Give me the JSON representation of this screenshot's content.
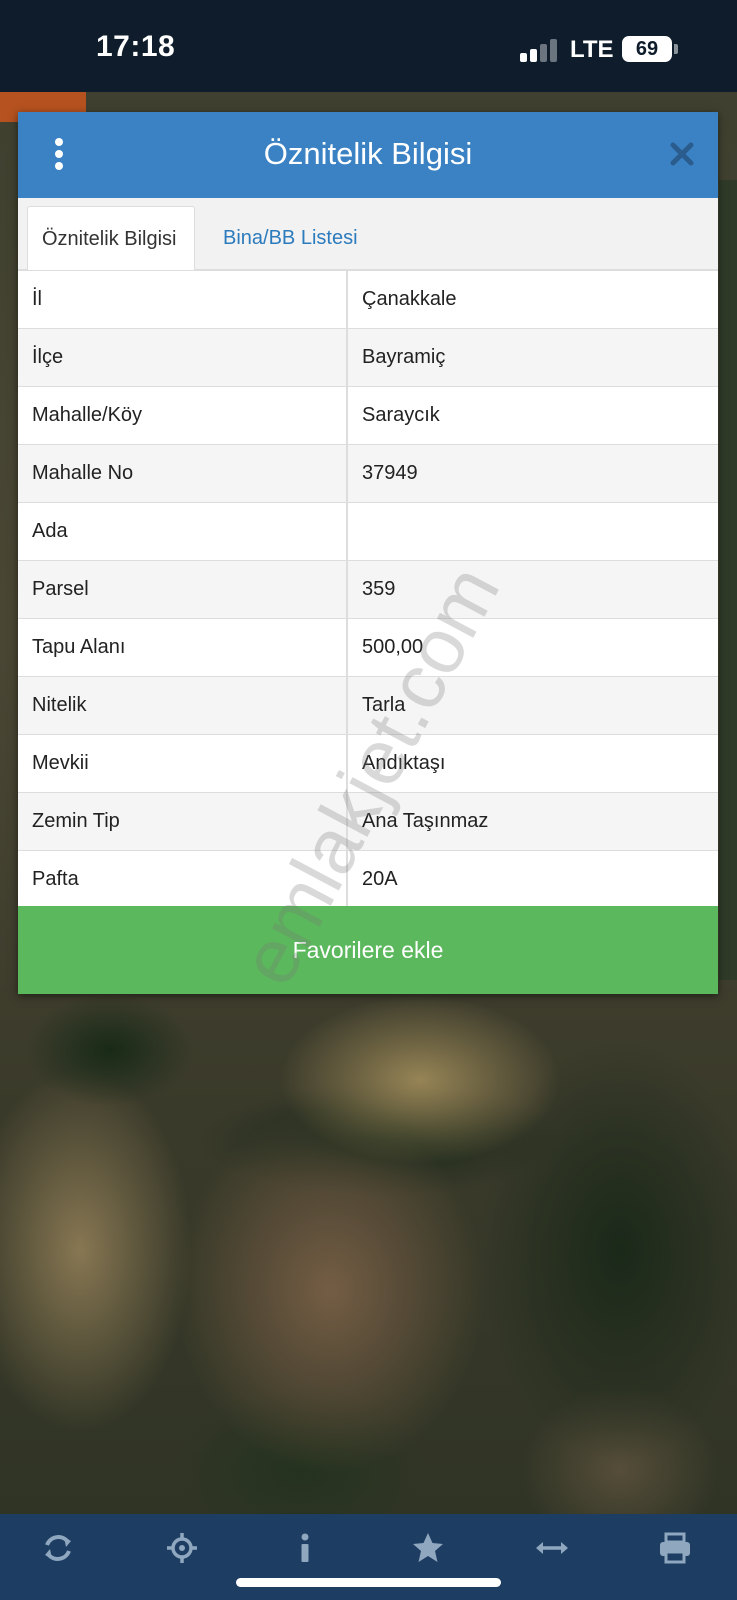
{
  "status_bar": {
    "time": "17:18",
    "network": "LTE",
    "battery": "69"
  },
  "dialog": {
    "title": "Öznitelik Bilgisi",
    "icons": {
      "menu": "more-vertical-icon",
      "close": "close-icon"
    },
    "tabs": [
      {
        "label": "Öznitelik Bilgisi",
        "active": true
      },
      {
        "label": "Bina/BB Listesi",
        "active": false
      }
    ],
    "rows": [
      {
        "key": "İl",
        "value": "Çanakkale"
      },
      {
        "key": "İlçe",
        "value": "Bayramiç"
      },
      {
        "key": "Mahalle/Köy",
        "value": "Saraycık"
      },
      {
        "key": "Mahalle No",
        "value": "37949"
      },
      {
        "key": "Ada",
        "value": ""
      },
      {
        "key": "Parsel",
        "value": "359"
      },
      {
        "key": "Tapu Alanı",
        "value": "500,00"
      },
      {
        "key": "Nitelik",
        "value": "Tarla"
      },
      {
        "key": "Mevkii",
        "value": "Andıktaşı"
      },
      {
        "key": "Zemin Tip",
        "value": "Ana Taşınmaz"
      },
      {
        "key": "Pafta",
        "value": "20A"
      }
    ],
    "favorite_button": "Favorilere ekle"
  },
  "watermark": "emlakjet.com",
  "toolbar": {
    "items": [
      "refresh-icon",
      "locate-icon",
      "info-icon",
      "star-icon",
      "measure-icon",
      "print-icon"
    ]
  },
  "colors": {
    "header": "#3b82c4",
    "button": "#5cb85c",
    "toolbar": "#1e3d63",
    "status_bar": "#0f1c2b",
    "tab_link": "#2c7bbd"
  }
}
